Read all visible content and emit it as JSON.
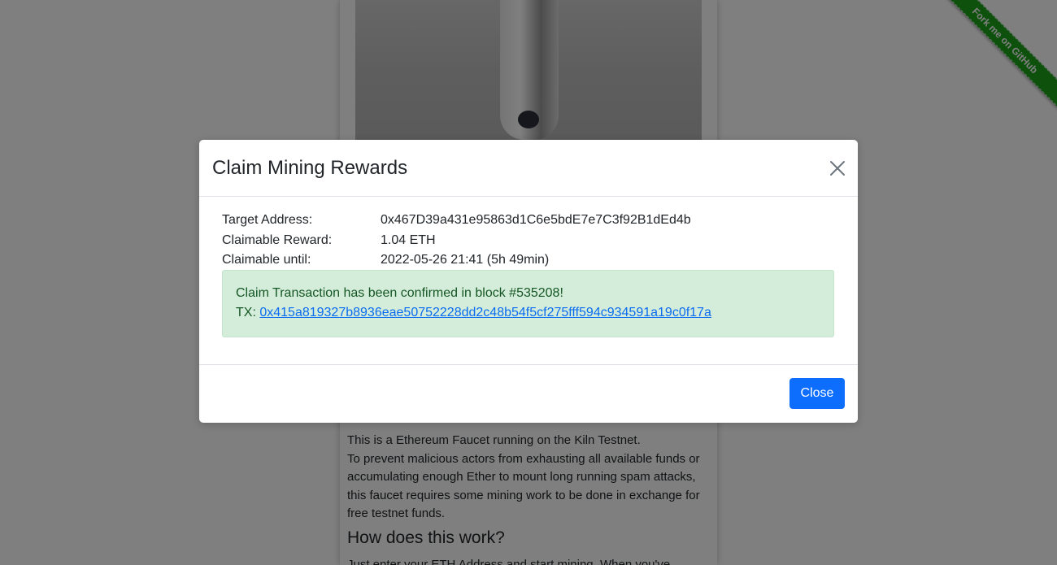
{
  "page": {
    "intro_lines": [
      "This is a Ethereum Faucet running on the Kiln Testnet.",
      "To prevent malicious actors from exhausting all available funds or accumulating enough Ether to mount long running spam attacks, this faucet requires some mining work to be done in exchange for free testnet funds."
    ],
    "how_heading": "How does this work?",
    "how_text": "Just enter your ETH Address and start mining. When you've"
  },
  "ribbon": {
    "label": "Fork me on GitHub",
    "color": "#1aa31a"
  },
  "modal": {
    "title": "Claim Mining Rewards",
    "close_icon": "close-icon",
    "rows": [
      {
        "label": "Target Address:",
        "value": "0x467D39a431e95863d1C6e5bdE7e7C3f92B1dEd4b"
      },
      {
        "label": "Claimable Reward:",
        "value": "1.04 ETH"
      },
      {
        "label": "Claimable until:",
        "value": "2022-05-26 21:41 (5h 49min)"
      }
    ],
    "alert": {
      "message": "Claim Transaction has been confirmed in block #535208!",
      "tx_prefix": "TX:",
      "tx_hash": "0x415a819327b8936eae50752228dd2c48b54f5cf275fff594c934591a19c0f17a"
    },
    "close_button_label": "Close"
  },
  "colors": {
    "primary": "#0d6efd",
    "success_bg": "#d4edda",
    "success_text": "#155724"
  }
}
